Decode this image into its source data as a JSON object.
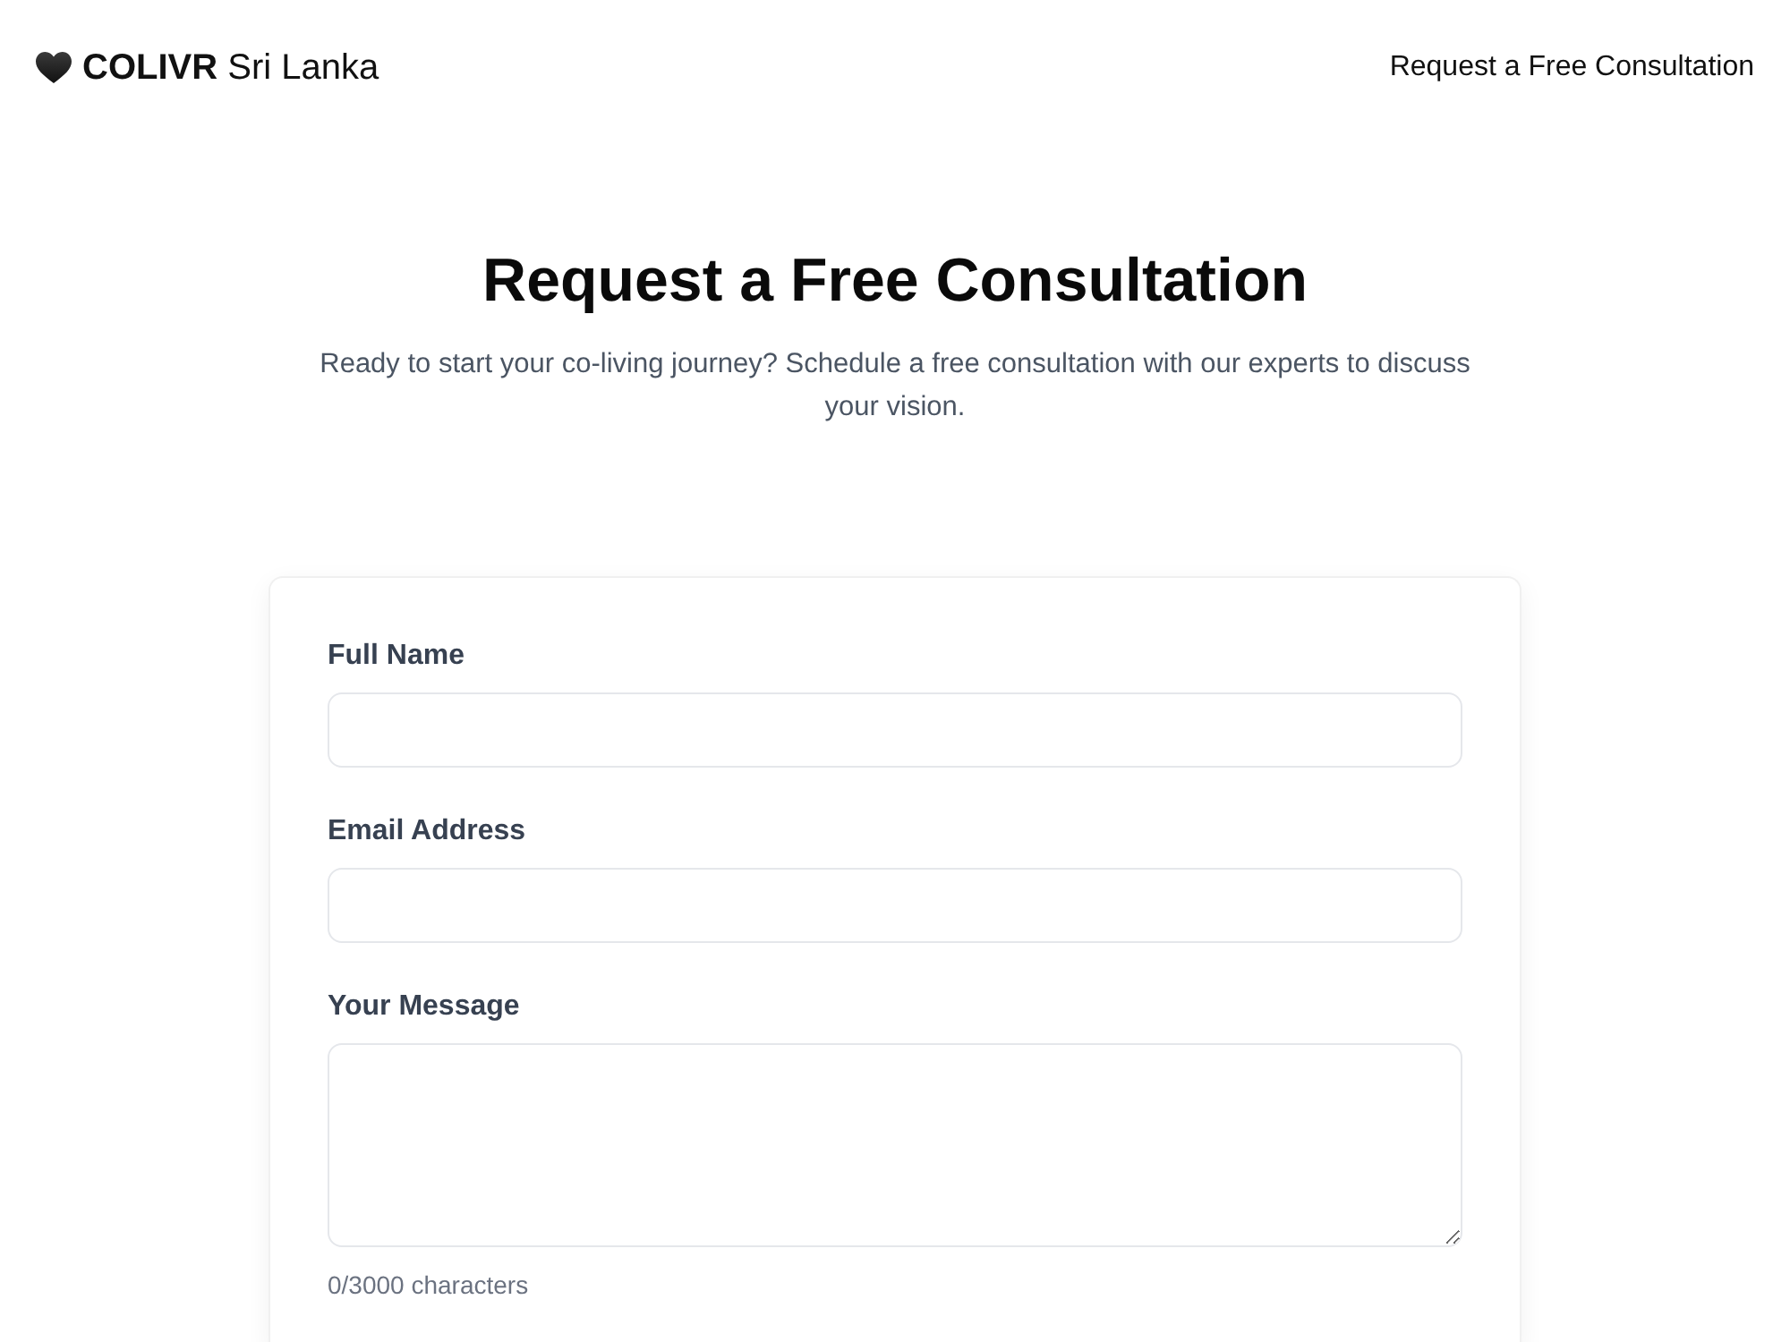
{
  "header": {
    "logo": "**COLIVR** Sri Lanka",
    "nav_link": "Request a Free Consultation"
  },
  "hero": {
    "title": "Request a Free Consultation",
    "subtitle": "Ready to start your co-living journey? Schedule a free consultation with our experts to discuss your vision."
  },
  "form": {
    "fields": [
      {
        "kind": "text",
        "label": "Full Name"
      },
      {
        "kind": "email",
        "label": "Email Address"
      },
      {
        "kind": "textarea",
        "label": "Your Message",
        "counter": "0/3000 characters"
      }
    ]
  }
}
